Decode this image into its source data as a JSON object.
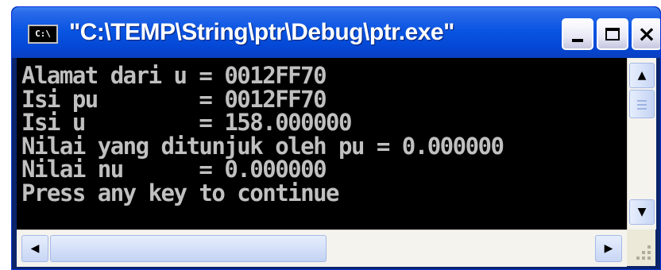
{
  "window": {
    "title": "\"C:\\TEMP\\String\\ptr\\Debug\\ptr.exe\"",
    "icon_text": "C:\\",
    "icon": "console-icon"
  },
  "titlebar_buttons": {
    "minimize": "minimize-icon",
    "maximize": "maximize-icon",
    "close": "close-icon",
    "close_glyph": "×"
  },
  "console": {
    "lines": [
      "Alamat dari u = 0012FF70",
      "Isi pu        = 0012FF70",
      "Isi u         = 158.000000",
      "Nilai yang ditunjuk oleh pu = 0.000000",
      "Nilai nu      = 0.000000",
      "Press any key to continue"
    ]
  },
  "scrollbars": {
    "up_glyph": "▲",
    "down_glyph": "▼",
    "left_glyph": "◀",
    "right_glyph": "▶"
  },
  "colors": {
    "titlebar": "#0a55e3",
    "console_bg": "#000000",
    "console_text": "#c0c0c0"
  }
}
